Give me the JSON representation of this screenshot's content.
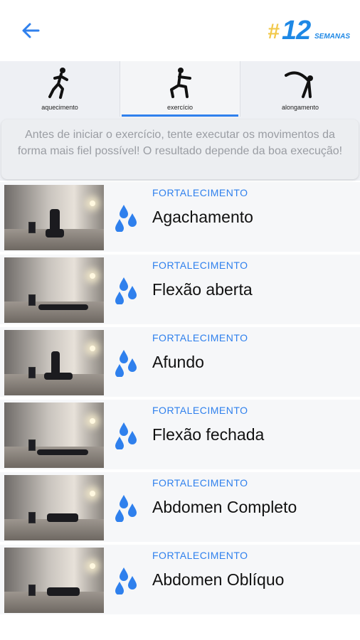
{
  "header": {
    "back_icon": "back-arrow-icon",
    "logo": {
      "hash": "#",
      "number": "12",
      "subtitle": "SEMANAS"
    },
    "colors": {
      "accent": "#2f80ed",
      "logo_yellow": "#f2c94c"
    }
  },
  "tabs": [
    {
      "label": "aquecimento",
      "icon": "running-figure-icon",
      "active": false
    },
    {
      "label": "exercício",
      "icon": "squat-figure-icon",
      "active": true
    },
    {
      "label": "alongamento",
      "icon": "stretch-figure-icon",
      "active": false
    }
  ],
  "notice": {
    "text": "Antes de iniciar o exercício, tente executar os movimentos da forma mais fiel possível! O resultado depende da boa execução!"
  },
  "exercises": [
    {
      "category": "FORTALECIMENTO",
      "name": "Agachamento",
      "icon": "water-drops-icon"
    },
    {
      "category": "FORTALECIMENTO",
      "name": "Flexão aberta",
      "icon": "water-drops-icon"
    },
    {
      "category": "FORTALECIMENTO",
      "name": "Afundo",
      "icon": "water-drops-icon"
    },
    {
      "category": "FORTALECIMENTO",
      "name": "Flexão fechada",
      "icon": "water-drops-icon"
    },
    {
      "category": "FORTALECIMENTO",
      "name": "Abdomen Completo",
      "icon": "water-drops-icon"
    },
    {
      "category": "FORTALECIMENTO",
      "name": "Abdomen Oblíquo",
      "icon": "water-drops-icon"
    }
  ]
}
